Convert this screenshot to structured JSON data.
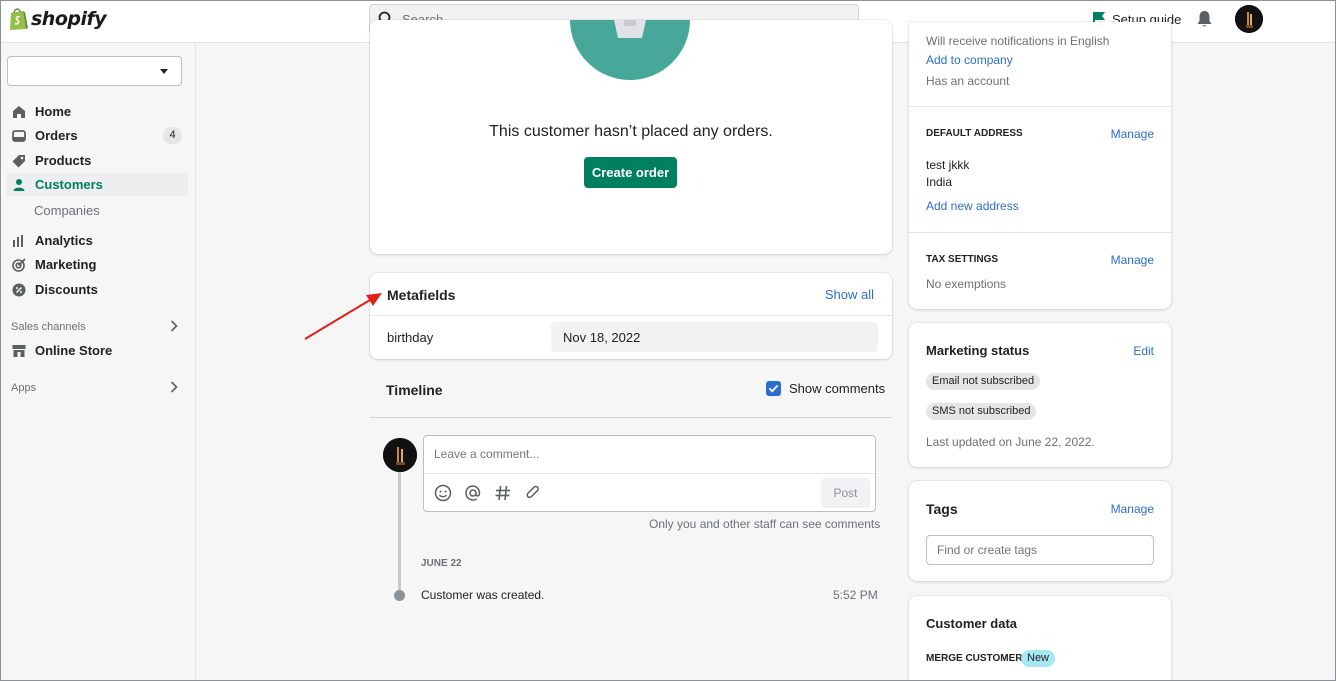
{
  "brand": {
    "name": "shopify"
  },
  "search": {
    "placeholder": "Search"
  },
  "topbar": {
    "setup_guide": "Setup guide"
  },
  "sidebar": {
    "items": [
      {
        "label": "Home",
        "icon": "home-icon"
      },
      {
        "label": "Orders",
        "icon": "orders-icon",
        "badge": "4"
      },
      {
        "label": "Products",
        "icon": "tag-icon"
      },
      {
        "label": "Customers",
        "icon": "person-icon",
        "active": true
      },
      {
        "label": "Companies",
        "sub": true
      },
      {
        "label": "Analytics",
        "icon": "bar-chart-icon"
      },
      {
        "label": "Marketing",
        "icon": "target-icon"
      },
      {
        "label": "Discounts",
        "icon": "discount-icon"
      }
    ],
    "sales_channels_label": "Sales channels",
    "online_store": "Online Store",
    "apps_label": "Apps"
  },
  "orders_card": {
    "empty_text": "This customer hasn’t placed any orders.",
    "create_button": "Create order"
  },
  "metafields": {
    "title": "Metafields",
    "show_all": "Show all",
    "rows": [
      {
        "key": "birthday",
        "value": "Nov 18, 2022"
      }
    ]
  },
  "timeline": {
    "title": "Timeline",
    "show_comments": "Show comments",
    "show_comments_checked": true,
    "comment_placeholder": "Leave a comment...",
    "post_button": "Post",
    "staff_note": "Only you and other staff can see comments",
    "date_header": "JUNE 22",
    "events": [
      {
        "text": "Customer was created.",
        "time": "5:52 PM"
      }
    ]
  },
  "customer_panel": {
    "cut_text": "Will receive notifications in English",
    "add_to_company": "Add to company",
    "account_status": "Has an account",
    "default_address": {
      "title": "DEFAULT ADDRESS",
      "manage": "Manage",
      "lines": [
        "test jkkk",
        "India"
      ],
      "add_new": "Add new address"
    },
    "tax": {
      "title": "TAX SETTINGS",
      "manage": "Manage",
      "value": "No exemptions"
    }
  },
  "marketing_status": {
    "title": "Marketing status",
    "edit": "Edit",
    "email_badge": "Email not subscribed",
    "sms_badge": "SMS not subscribed",
    "last_updated": "Last updated on June 22, 2022."
  },
  "tags": {
    "title": "Tags",
    "manage": "Manage",
    "placeholder": "Find or create tags"
  },
  "customer_data": {
    "title": "Customer data",
    "merge_label": "MERGE CUSTOMER",
    "new_badge": "New"
  },
  "colors": {
    "primary": "#008060",
    "link": "#2c6ecb",
    "annotation_arrow": "#e0201b",
    "new_badge_bg": "#a4e8f2"
  }
}
